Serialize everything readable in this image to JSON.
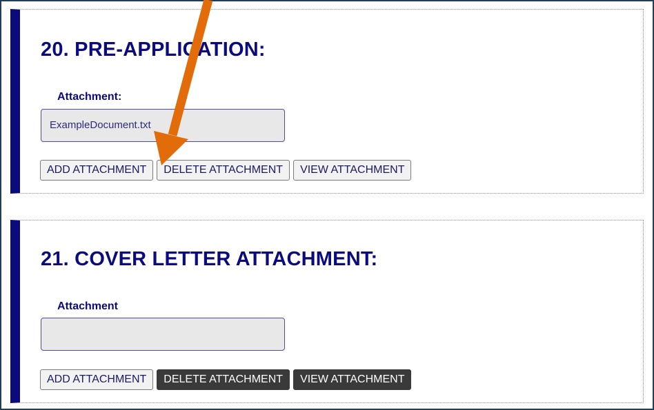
{
  "sections": [
    {
      "title": "20. PRE-APPLICATION:",
      "field_label": "Attachment:",
      "file_value": "ExampleDocument.txt",
      "buttons": {
        "add": "ADD ATTACHMENT",
        "delete": "DELETE ATTACHMENT",
        "view": "VIEW ATTACHMENT"
      }
    },
    {
      "title": "21. COVER LETTER ATTACHMENT:",
      "field_label": "Attachment",
      "file_value": "",
      "buttons": {
        "add": "ADD ATTACHMENT",
        "delete": "DELETE ATTACHMENT",
        "view": "VIEW ATTACHMENT"
      }
    }
  ],
  "colors": {
    "accent_navy": "#0b0b7e",
    "annotation_arrow": "#e36c0a",
    "disabled_button": "#3a3a3a"
  },
  "annotation": {
    "icon": "arrow-pointing-down-left",
    "target": "add-attachment-button"
  }
}
